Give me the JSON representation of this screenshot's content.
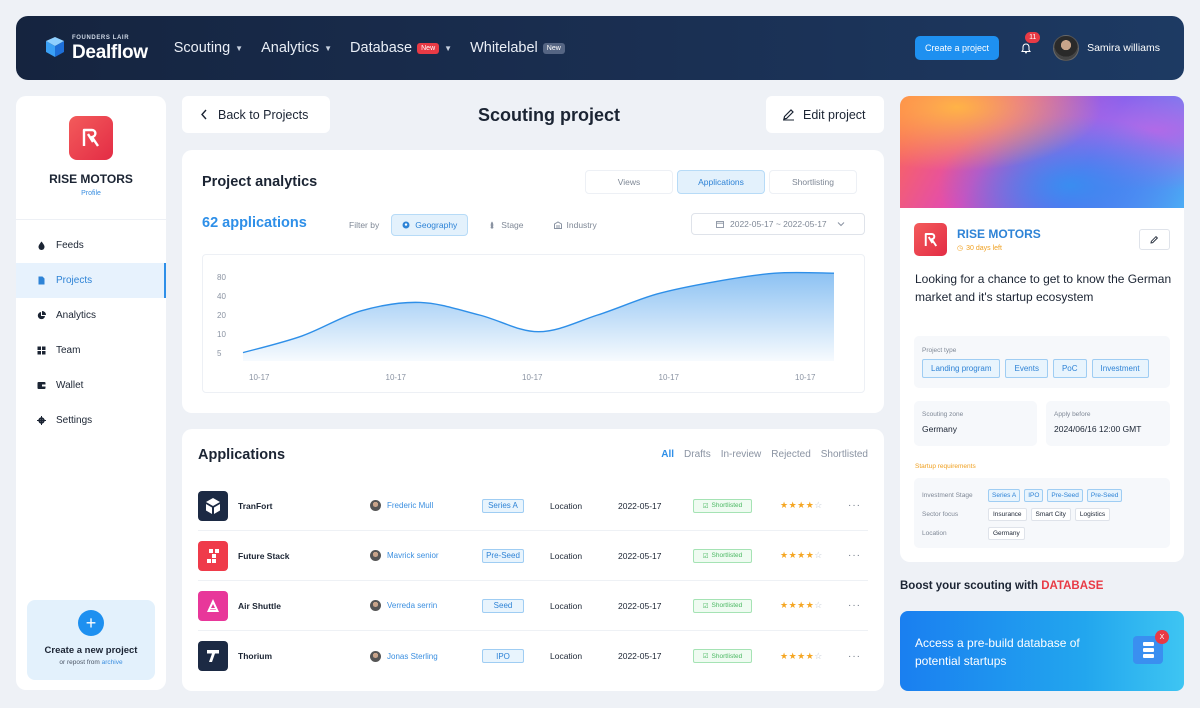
{
  "brand": {
    "super": "FOUNDERS LAIR",
    "name": "Dealflow"
  },
  "nav": {
    "scouting": "Scouting",
    "analytics": "Analytics",
    "database": "Database",
    "database_badge": "New",
    "whitelabel": "Whitelabel",
    "whitelabel_badge": "New"
  },
  "topbar": {
    "create_label": "Create a project",
    "notifications": "11",
    "user_name": "Samira williams"
  },
  "sidebar": {
    "profile_name": "RISE MOTORS",
    "profile_sub": "Profile",
    "items": [
      {
        "label": "Feeds"
      },
      {
        "label": "Projects"
      },
      {
        "label": "Analytics"
      },
      {
        "label": "Team"
      },
      {
        "label": "Wallet"
      },
      {
        "label": "Settings"
      }
    ],
    "create_title": "Create a new project",
    "create_sub_prefix": "or repost from",
    "create_sub_link": "archive"
  },
  "header": {
    "back_label": "Back to Projects",
    "title": "Scouting project",
    "edit_label": "Edit project"
  },
  "analytics": {
    "title": "Project analytics",
    "tabs": [
      "Views",
      "Applications",
      "Shortlisting"
    ],
    "active_tab": "Applications",
    "count": "62 applications",
    "filter_by": "Filter by",
    "filters": [
      "Geography",
      "Stage",
      "Industry"
    ],
    "date_range": "2022-05-17 ~ 2022-05-17"
  },
  "chart_data": {
    "type": "area",
    "y_ticks": [
      "80",
      "40",
      "20",
      "10",
      "5"
    ],
    "x_ticks": [
      "10-17",
      "10-17",
      "10-17",
      "10-17",
      "10-17"
    ],
    "x": [
      0,
      0.1,
      0.2,
      0.3,
      0.4,
      0.5,
      0.6,
      0.7,
      0.8,
      0.9,
      1.0
    ],
    "values": [
      2,
      6,
      12,
      14,
      11,
      7,
      11,
      16,
      19,
      21,
      21
    ],
    "ylim": [
      0,
      22
    ],
    "grid": false,
    "color": "#2e8fe8"
  },
  "applications": {
    "title": "Applications",
    "tabs": [
      "All",
      "Drafts",
      "In-review",
      "Rejected",
      "Shortlisted"
    ],
    "active_tab": "All",
    "rows": [
      {
        "company": "TranFort",
        "person": "Frederic Mull",
        "stage": "Series A",
        "location": "Location",
        "date": "2022-05-17",
        "status": "Shortlisted",
        "rating": 4,
        "logo_color": "#1c2a44"
      },
      {
        "company": "Future Stack",
        "person": "Mavrick senior",
        "stage": "Pre-Seed",
        "location": "Location",
        "date": "2022-05-17",
        "status": "Shortlisted",
        "rating": 4,
        "logo_color": "#ef3b4a"
      },
      {
        "company": "Air Shuttle",
        "person": "Verreda serrin",
        "stage": "Seed",
        "location": "Location",
        "date": "2022-05-17",
        "status": "Shortlisted",
        "rating": 4,
        "logo_color": "#e8379a"
      },
      {
        "company": "Thorium",
        "person": "Jonas Sterling",
        "stage": "IPO",
        "location": "Location",
        "date": "2022-05-17",
        "status": "Shortlisted",
        "rating": 4,
        "logo_color": "#1c2a44"
      }
    ]
  },
  "project_panel": {
    "name": "RISE MOTORS",
    "days_left": "30 days left",
    "description": "Looking for a chance to get to know the German market and it's startup ecosystem",
    "project_type_label": "Project type",
    "project_types": [
      "Landing program",
      "Events",
      "PoC",
      "Investment"
    ],
    "scouting_zone_label": "Scouting zone",
    "scouting_zone": "Germany",
    "apply_before_label": "Apply before",
    "apply_before": "2024/06/16 12:00 GMT",
    "requirements_label": "Startup requirements",
    "investment_stage_label": "Investment Stage",
    "investment_stages": [
      "Series A",
      "IPO",
      "Pre-Seed",
      "Pre-Seed"
    ],
    "sector_focus_label": "Sector focus",
    "sectors": [
      "Insurance",
      "Smart City",
      "Logistics"
    ],
    "location_label": "Location",
    "locations": [
      "Germany"
    ]
  },
  "promo": {
    "boost_prefix": "Boost your scouting with",
    "boost_highlight": "DATABASE",
    "card_text": "Access a pre-build database of potential startups",
    "close": "X"
  },
  "colors": {
    "accent": "#2e8fe8",
    "brand_red": "#e83a45",
    "nav_bg": "#15243f",
    "star": "#f5a623",
    "success": "#4bb862"
  }
}
